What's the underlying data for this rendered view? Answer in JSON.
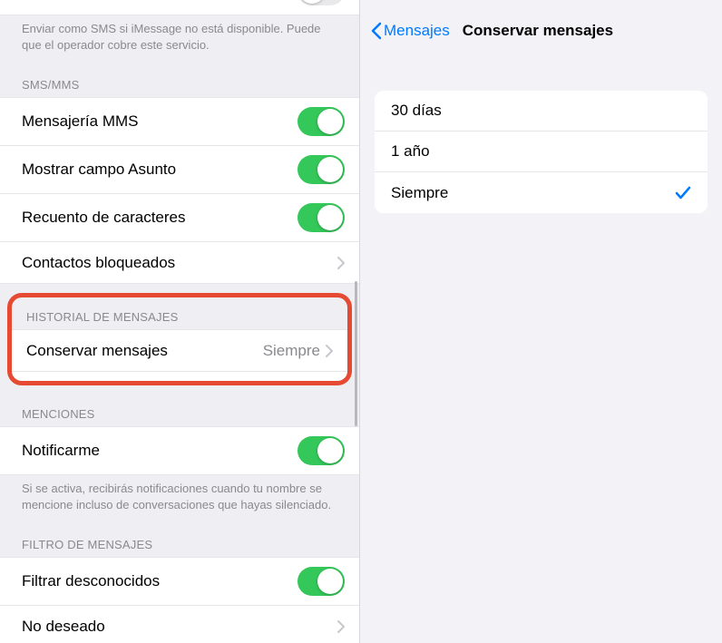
{
  "left": {
    "trunc_row_label": "",
    "trunc_footer": "Enviar como SMS si iMessage no está disponible. Puede que el operador cobre este servicio.",
    "sms_section": {
      "header": "SMS/MMS",
      "rows": [
        {
          "label": "Mensajería MMS",
          "toggle": true
        },
        {
          "label": "Mostrar campo Asunto",
          "toggle": true
        },
        {
          "label": "Recuento de caracteres",
          "toggle": true
        },
        {
          "label": "Contactos bloqueados",
          "disclosure": true
        }
      ]
    },
    "history_section": {
      "header": "HISTORIAL DE MENSAJES",
      "row_label": "Conservar mensajes",
      "row_value": "Siempre"
    },
    "mentions_section": {
      "header": "MENCIONES",
      "row_label": "Notificarme",
      "footer": "Si se activa, recibirás notificaciones cuando tu nombre se mencione incluso de conversaciones que hayas silenciado."
    },
    "filter_section": {
      "header": "FILTRO DE MENSAJES",
      "rows": [
        {
          "label": "Filtrar desconocidos",
          "toggle": true
        },
        {
          "label": "No deseado",
          "disclosure": true
        }
      ]
    }
  },
  "right": {
    "back_label": "Mensajes",
    "title": "Conservar mensajes",
    "options": [
      {
        "label": "30 días",
        "selected": false
      },
      {
        "label": "1 año",
        "selected": false
      },
      {
        "label": "Siempre",
        "selected": true
      }
    ]
  }
}
